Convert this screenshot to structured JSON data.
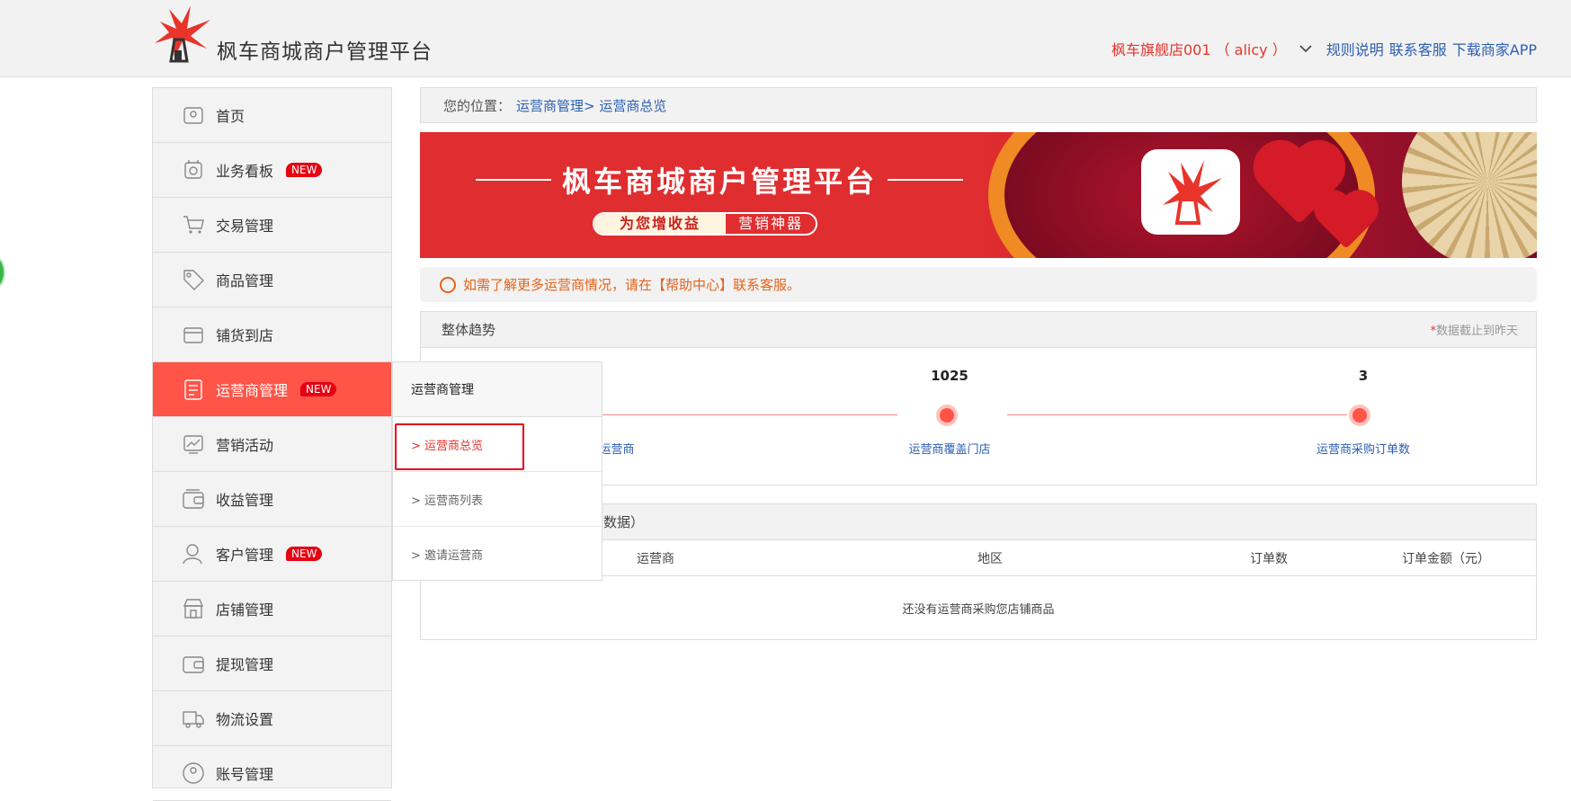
{
  "header": {
    "site_title": "枫车商城商户管理平台",
    "store_name": "枫车旗舰店001 （ alicy ）",
    "links": [
      "规则说明",
      "联系客服",
      "下载商家APP"
    ]
  },
  "sidebar": {
    "items": [
      {
        "label": "首页",
        "icon": "home-icon",
        "new": false
      },
      {
        "label": "业务看板",
        "icon": "dashboard-icon",
        "new": true
      },
      {
        "label": "交易管理",
        "icon": "cart-icon",
        "new": false
      },
      {
        "label": "商品管理",
        "icon": "tag-icon",
        "new": false
      },
      {
        "label": "铺货到店",
        "icon": "store-icon",
        "new": false
      },
      {
        "label": "运营商管理",
        "icon": "document-icon",
        "new": true,
        "active": true
      },
      {
        "label": "营销活动",
        "icon": "chart-icon",
        "new": false
      },
      {
        "label": "收益管理",
        "icon": "wallet-icon",
        "new": false
      },
      {
        "label": "客户管理",
        "icon": "user-icon",
        "new": true
      },
      {
        "label": "店铺管理",
        "icon": "shop-icon",
        "new": false
      },
      {
        "label": "提现管理",
        "icon": "withdraw-icon",
        "new": false
      },
      {
        "label": "物流设置",
        "icon": "truck-icon",
        "new": false
      },
      {
        "label": "账号管理",
        "icon": "account-icon",
        "new": false
      }
    ],
    "new_badge": "NEW"
  },
  "submenu": {
    "title": "运营商管理",
    "items": [
      "> 运营商总览",
      "> 运营商列表",
      "> 邀请运营商"
    ]
  },
  "breadcrumb": {
    "prefix": "您的位置：",
    "path": "运营商管理> 运营商总览"
  },
  "banner": {
    "title": "枫车商城商户管理平台",
    "pill_left": "为您增收益",
    "pill_right": "营销神器"
  },
  "notice": {
    "text": "如需了解更多运营商情况，请在【帮助中心】联系客服。"
  },
  "trend": {
    "title": "整体趋势",
    "note_star": "*",
    "note": "数据截止到昨天",
    "stats": [
      {
        "value": "",
        "label": "运营商"
      },
      {
        "value": "1025",
        "label": "运营商覆盖门店"
      },
      {
        "value": "3",
        "label": "运营商采购订单数"
      }
    ]
  },
  "orders": {
    "title_partial": "数据）",
    "columns": [
      "运营商",
      "地区",
      "订单数",
      "订单金额（元）"
    ],
    "empty_text": "还没有运营商采购您店铺商品"
  },
  "colors": {
    "accent": "#ff5448",
    "link": "#2c5fb3",
    "notice": "#e8631a"
  }
}
